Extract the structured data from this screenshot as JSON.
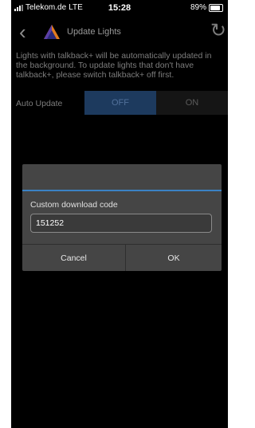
{
  "status": {
    "carrier": "Telekom.de",
    "network": "LTE",
    "time": "15:28",
    "battery": "89%",
    "battery_level": 0.89
  },
  "nav": {
    "title": "Update Lights",
    "back_icon": "chevron-left-icon",
    "refresh_icon": "refresh-icon"
  },
  "info_text": "Lights with talkback+ will be automatically updated in the background. To update lights that don't have talkback+, please switch talkback+ off first.",
  "auto_update": {
    "label": "Auto Update",
    "off_label": "OFF",
    "on_label": "ON",
    "selected": "OFF"
  },
  "dialog": {
    "label": "Custom download code",
    "value": "151252",
    "cancel_label": "Cancel",
    "ok_label": "OK"
  },
  "colors": {
    "accent": "#3b82c4",
    "selected_segment": "#1d3a5e",
    "dialog_bg": "#454545"
  }
}
